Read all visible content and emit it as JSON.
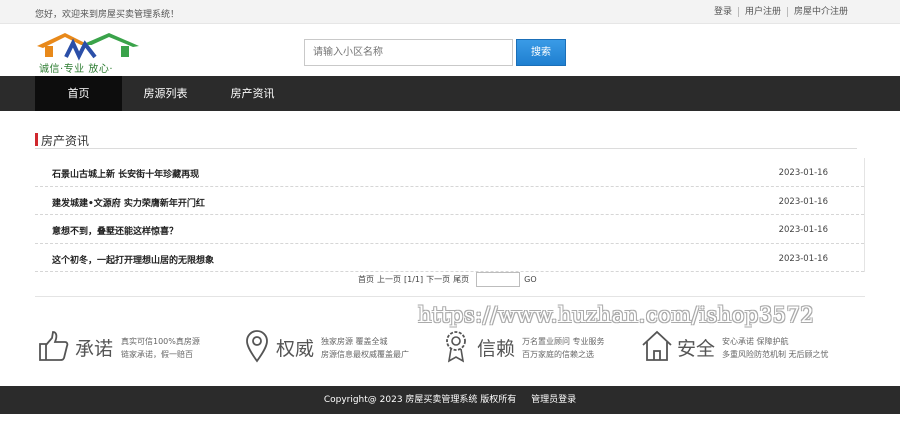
{
  "topbar": {
    "welcome": "您好，欢迎来到房屋买卖管理系统！",
    "links": [
      "登录",
      "用户注册",
      "房屋中介注册"
    ]
  },
  "header": {
    "slogan": "诚信·专业  放心·",
    "search_placeholder": "请输入小区名称",
    "search_button": "搜索"
  },
  "nav": {
    "items": [
      "首页",
      "房源列表",
      "房产资讯"
    ],
    "active": "首页"
  },
  "section": {
    "title": "房产资讯"
  },
  "news": [
    {
      "title": "石景山古城上新 长安街十年珍藏再现",
      "date": "2023-01-16"
    },
    {
      "title": "建发城建•文源府 实力荣膺新年开门红",
      "date": "2023-01-16"
    },
    {
      "title": "意想不到，叠墅还能这样惊喜？",
      "date": "2023-01-16"
    },
    {
      "title": "这个初冬，一起打开理想山居的无限想象",
      "date": "2023-01-16"
    }
  ],
  "pager": {
    "first": "首页",
    "prev": "上一页",
    "info": "[1/1]",
    "next": "下一页",
    "last": "尾页",
    "go": "GO"
  },
  "watermark": "https://www.huzhan.com/ishop3572",
  "features": [
    {
      "icon": "thumbs-up-icon",
      "title": "承诺",
      "line1": "真实可信100%真房源",
      "line2": "链家承诺，假一赔百"
    },
    {
      "icon": "location-pin-icon",
      "title": "权威",
      "line1": "独家房源 覆盖全城",
      "line2": "房源信息最权威覆盖最广"
    },
    {
      "icon": "badge-icon",
      "title": "信赖",
      "line1": "万名置业顾问 专业服务",
      "line2": "百万家庭的信赖之选"
    },
    {
      "icon": "house-icon",
      "title": "安全",
      "line1": "安心承诺 保障护航",
      "line2": "多重风险防范机制 无后顾之忧"
    }
  ],
  "footer": {
    "copyright": "Copyright@ 2023 房屋买卖管理系统 版权所有",
    "admin_link": "管理员登录"
  },
  "colors": {
    "nav_bg": "#2b2b2b",
    "nav_active": "#0d0d0d",
    "accent_red": "#d0282e",
    "search_blue": "#1f7fd0"
  }
}
